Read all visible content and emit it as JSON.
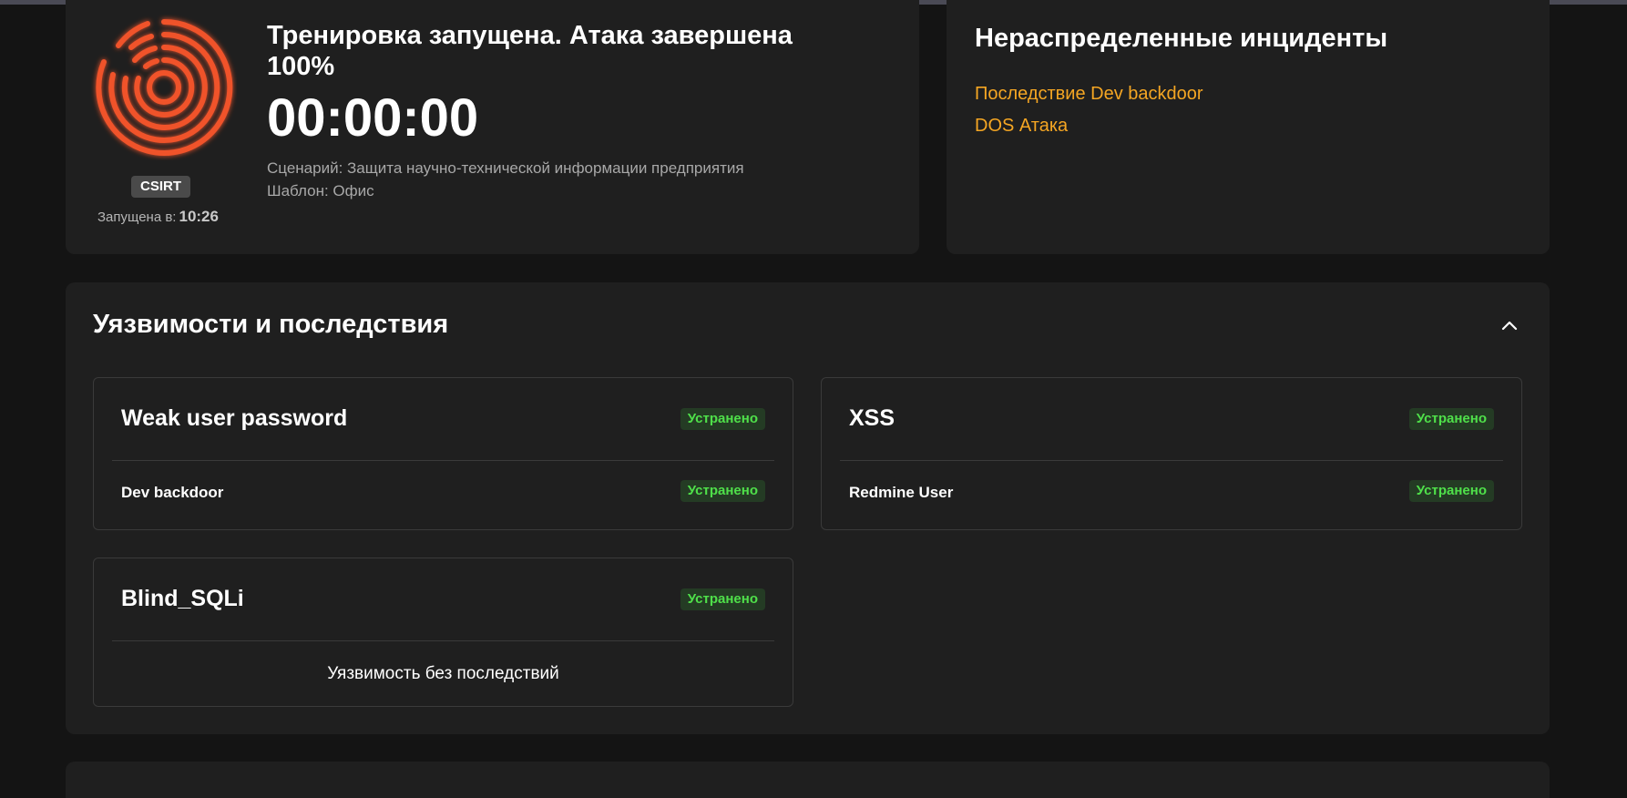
{
  "status": {
    "role_badge": "CSIRT",
    "started_label": "Запущена в:",
    "started_time": "10:26",
    "title": "Тренировка запущена. Атака завершена 100%",
    "timer": "00:00:00",
    "scenario": "Сценарий: Защита научно-технической информации предприятия",
    "template": "Шаблон: Офис",
    "logo_icon": "concentric-rings-logo-icon",
    "logo_color": "#f0522a"
  },
  "incidents": {
    "title": "Нераспределенные инциденты",
    "items": [
      "Последствие Dev backdoor",
      "DOS Атака"
    ],
    "link_color": "#f5a623"
  },
  "vulnerabilities": {
    "title": "Уязвимости и последствия",
    "collapse_icon": "chevron-up-icon",
    "cards": [
      {
        "name": "Weak user password",
        "status": "Устранено",
        "consequence": "Dev backdoor",
        "consequence_status": "Устранено"
      },
      {
        "name": "XSS",
        "status": "Устранено",
        "consequence": "Redmine User",
        "consequence_status": "Устранено"
      },
      {
        "name": "Blind_SQLi",
        "status": "Устранено",
        "empty_text": "Уязвимость без последствий"
      }
    ],
    "status_color": "#4fe04a"
  }
}
